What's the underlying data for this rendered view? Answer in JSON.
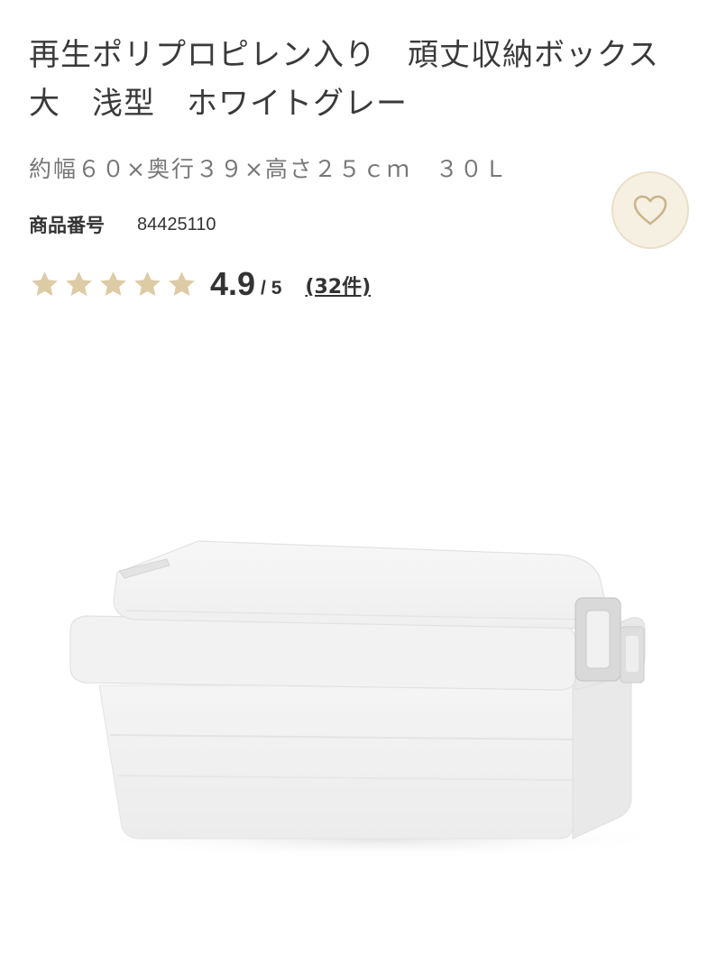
{
  "product": {
    "title": "再生ポリプロピレン入り　頑丈収納ボックス　大　浅型　ホワイトグレー",
    "size_spec": "約幅６０×奥行３９×高さ２５ｃｍ　３０Ｌ",
    "number_label": "商品番号",
    "number_value": "84425110"
  },
  "favorite": {
    "icon": "heart-icon",
    "color": "#c9b48c",
    "background": "#f6f0e2"
  },
  "rating": {
    "score": "4.9",
    "max": "/ 5",
    "stars_filled": 5,
    "stars_total": 5,
    "star_color": "#dccba4",
    "review_count": "(32件)"
  },
  "image": {
    "subject": "storage-box-image"
  }
}
